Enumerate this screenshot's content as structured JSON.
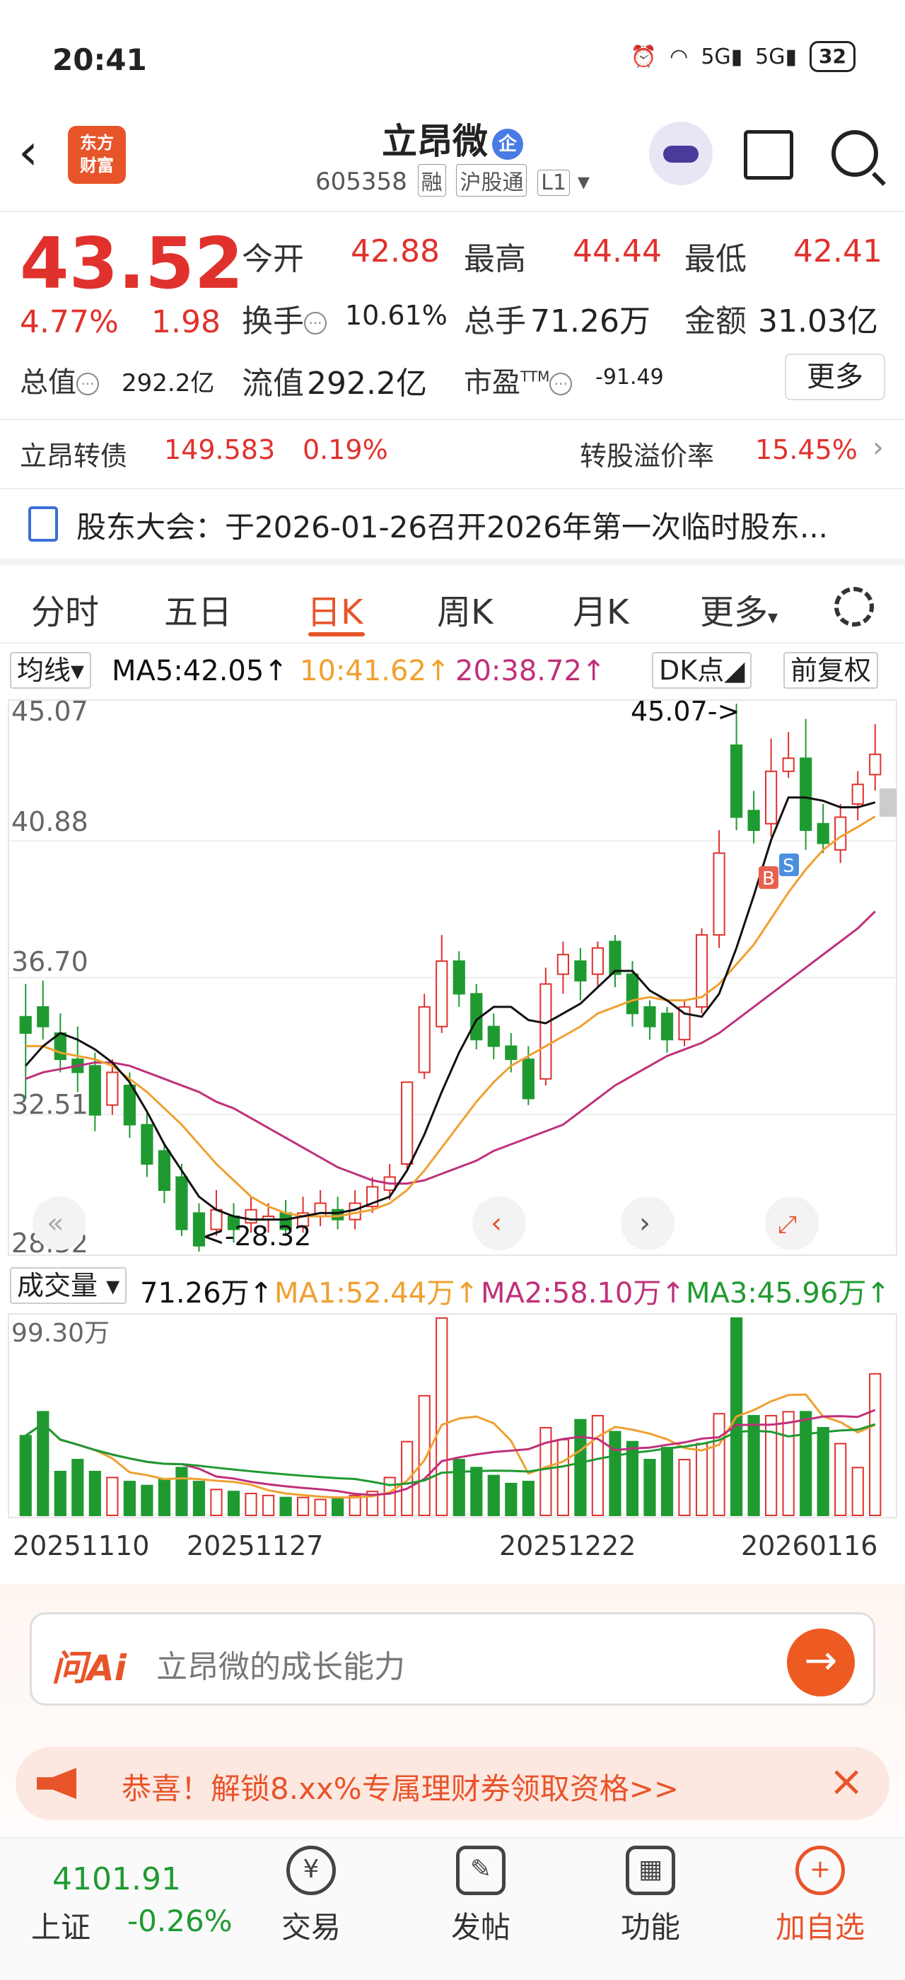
{
  "status_bar": {
    "time": "20:41",
    "signal1": "5G",
    "signal2": "5G",
    "battery": "32"
  },
  "header": {
    "title": "立昂微",
    "badge": "企",
    "code": "605358",
    "tags": [
      "融",
      "沪股通",
      "L1"
    ],
    "logo_line1": "东方",
    "logo_line2": "财富"
  },
  "quote": {
    "price": "43.52",
    "change_pct": "4.77%",
    "change": "1.98",
    "open_label": "今开",
    "open": "42.88",
    "high_label": "最高",
    "high": "44.44",
    "low_label": "最低",
    "low": "42.41",
    "turnover_label": "换手",
    "turnover": "10.61%",
    "volume_label": "总手",
    "volume": "71.26万",
    "amount_label": "金额",
    "amount": "31.03亿",
    "mcap_label": "总值",
    "mcap": "292.2亿",
    "float_label": "流值",
    "float": "292.2亿",
    "pe_label": "市盈",
    "pe_sup": "TTM",
    "pe": "-91.49",
    "more": "更多"
  },
  "bond": {
    "name": "立昂转债",
    "price": "149.583",
    "pct": "0.19%",
    "premium_label": "转股溢价率",
    "premium": "15.45%"
  },
  "notice": {
    "text": "股东大会：于2026-01-26召开2026年第一次临时股东..."
  },
  "tabs": [
    {
      "label": "分时"
    },
    {
      "label": "五日"
    },
    {
      "label": "日K"
    },
    {
      "label": "周K"
    },
    {
      "label": "月K"
    },
    {
      "label": "更多"
    }
  ],
  "chart_header": {
    "ma_select": "均线",
    "ma5": "MA5:42.05↑",
    "ma10": "10:41.62↑",
    "ma20": "20:38.72↑",
    "dk": "DK点",
    "adjust": "前复权"
  },
  "chart_labels": {
    "y1": "45.07",
    "y2": "40.88",
    "y3": "36.70",
    "y4": "32.51",
    "y5": "28.32",
    "high_note": "45.07->",
    "low_note": "<-28.32",
    "buy": "B",
    "sell": "S"
  },
  "volume_header": {
    "select": "成交量",
    "vol": "71.26万↑",
    "ma1": "MA1:52.44万↑",
    "ma2": "MA2:58.10万↑",
    "ma3": "MA3:45.96万↑",
    "ymax": "99.30万"
  },
  "dates": [
    "20251110",
    "20251127",
    "20251222",
    "20260116"
  ],
  "ai": {
    "logo": "问Ai",
    "placeholder": "立昂微的成长能力"
  },
  "promo": {
    "text": "恭喜！解锁8.xx%专属理财券领取资格>>"
  },
  "index": {
    "value": "4101.91",
    "name": "上证",
    "pct": "-0.26%"
  },
  "nav": [
    {
      "label": "交易"
    },
    {
      "label": "发帖"
    },
    {
      "label": "功能"
    },
    {
      "label": "加自选"
    }
  ],
  "colors": {
    "up": "#e0312d",
    "down": "#1f9a31",
    "ma5": "#111111",
    "ma10": "#f0a030",
    "ma20": "#c0307a",
    "accent": "#e8542a"
  },
  "chart_data": {
    "type": "candlestick",
    "ylim": [
      28.32,
      45.07
    ],
    "candles": [
      [
        35.5,
        35.0,
        36.5,
        33.0
      ],
      [
        35.8,
        35.2,
        36.6,
        34.8
      ],
      [
        35.0,
        34.2,
        35.6,
        33.8
      ],
      [
        34.2,
        33.8,
        35.2,
        33.2
      ],
      [
        34.0,
        32.5,
        34.4,
        32.0
      ],
      [
        32.8,
        33.8,
        34.2,
        32.5
      ],
      [
        33.4,
        32.2,
        33.8,
        31.8
      ],
      [
        32.2,
        31.0,
        32.6,
        30.6
      ],
      [
        31.4,
        30.2,
        31.6,
        29.8
      ],
      [
        30.6,
        29.0,
        31.0,
        28.8
      ],
      [
        29.5,
        28.5,
        29.8,
        28.32
      ],
      [
        29.0,
        29.6,
        30.2,
        28.8
      ],
      [
        29.4,
        29.0,
        29.8,
        28.6
      ],
      [
        29.2,
        29.6,
        30.0,
        28.9
      ],
      [
        29.3,
        29.4,
        29.8,
        28.9
      ],
      [
        29.5,
        29.0,
        29.9,
        28.8
      ],
      [
        29.1,
        29.5,
        30.0,
        28.9
      ],
      [
        29.4,
        29.8,
        30.2,
        29.1
      ],
      [
        29.6,
        29.3,
        30.0,
        29.0
      ],
      [
        29.3,
        29.8,
        30.2,
        29.0
      ],
      [
        29.7,
        30.3,
        30.6,
        29.5
      ],
      [
        30.2,
        30.6,
        31.0,
        29.9
      ],
      [
        31.0,
        33.5,
        33.5,
        30.8
      ],
      [
        33.8,
        35.8,
        36.2,
        33.6
      ],
      [
        35.2,
        37.2,
        38.0,
        35.0
      ],
      [
        37.2,
        36.2,
        37.5,
        35.8
      ],
      [
        36.2,
        34.8,
        36.5,
        34.5
      ],
      [
        35.2,
        34.6,
        35.6,
        34.2
      ],
      [
        34.6,
        34.2,
        35.0,
        33.8
      ],
      [
        34.2,
        33.0,
        34.6,
        32.8
      ],
      [
        33.6,
        36.5,
        37.0,
        33.4
      ],
      [
        36.8,
        37.4,
        37.8,
        36.2
      ],
      [
        37.2,
        36.6,
        37.6,
        36.0
      ],
      [
        36.8,
        37.6,
        37.8,
        36.4
      ],
      [
        37.8,
        36.8,
        38.0,
        36.4
      ],
      [
        36.8,
        35.6,
        37.2,
        35.2
      ],
      [
        35.8,
        35.2,
        36.0,
        34.8
      ],
      [
        35.6,
        34.8,
        35.8,
        34.4
      ],
      [
        34.8,
        35.8,
        36.0,
        34.6
      ],
      [
        35.8,
        38.0,
        38.2,
        35.6
      ],
      [
        38.0,
        40.5,
        41.2,
        37.6
      ],
      [
        43.8,
        41.6,
        45.07,
        41.2
      ],
      [
        41.8,
        41.2,
        42.4,
        40.8
      ],
      [
        41.4,
        43.0,
        44.0,
        41.0
      ],
      [
        43.0,
        43.4,
        44.2,
        42.8
      ],
      [
        43.4,
        41.2,
        44.6,
        40.6
      ],
      [
        41.4,
        40.8,
        42.0,
        40.5
      ],
      [
        40.6,
        41.6,
        42.0,
        40.2
      ],
      [
        42.0,
        42.6,
        43.0,
        41.5
      ],
      [
        42.9,
        43.52,
        44.44,
        42.41
      ]
    ],
    "ma5": [
      34.0,
      34.6,
      35.0,
      34.8,
      34.5,
      34.1,
      33.5,
      32.6,
      31.6,
      30.8,
      30.0,
      29.6,
      29.4,
      29.3,
      29.3,
      29.3,
      29.4,
      29.5,
      29.5,
      29.6,
      29.8,
      30.0,
      30.8,
      31.9,
      33.2,
      34.4,
      35.4,
      35.8,
      35.8,
      35.4,
      35.3,
      35.6,
      35.9,
      36.4,
      36.9,
      36.9,
      36.3,
      36.0,
      35.6,
      35.5,
      36.2,
      37.6,
      39.2,
      40.9,
      42.2,
      42.2,
      42.1,
      41.9,
      41.9,
      42.05
    ],
    "ma10": [
      34.6,
      34.6,
      34.4,
      34.3,
      34.2,
      34.0,
      33.6,
      33.2,
      32.7,
      32.2,
      31.6,
      31.0,
      30.5,
      30.0,
      29.7,
      29.5,
      29.4,
      29.4,
      29.4,
      29.5,
      29.6,
      29.8,
      30.2,
      30.8,
      31.5,
      32.2,
      32.9,
      33.5,
      34.0,
      34.3,
      34.6,
      34.9,
      35.2,
      35.6,
      35.8,
      36.0,
      36.1,
      36.0,
      36.0,
      36.1,
      36.5,
      37.1,
      37.7,
      38.5,
      39.3,
      40.0,
      40.6,
      41.0,
      41.3,
      41.62
    ],
    "ma20": [
      33.6,
      33.8,
      33.9,
      34.0,
      34.1,
      34.1,
      34.0,
      33.8,
      33.6,
      33.4,
      33.2,
      32.9,
      32.7,
      32.4,
      32.1,
      31.8,
      31.5,
      31.2,
      30.9,
      30.7,
      30.5,
      30.4,
      30.4,
      30.5,
      30.7,
      30.9,
      31.1,
      31.4,
      31.6,
      31.8,
      32.0,
      32.2,
      32.6,
      33.0,
      33.4,
      33.7,
      34.0,
      34.3,
      34.5,
      34.7,
      35.0,
      35.4,
      35.8,
      36.2,
      36.6,
      37.0,
      37.4,
      37.8,
      38.2,
      38.72
    ],
    "volume": [
      40,
      52,
      22,
      28,
      22,
      19,
      17,
      15,
      18,
      24,
      17,
      13,
      12,
      11,
      10,
      9,
      9,
      8,
      9,
      10,
      12,
      19,
      37,
      60,
      99,
      28,
      24,
      20,
      16,
      17,
      44,
      38,
      48,
      50,
      42,
      37,
      28,
      34,
      28,
      36,
      51,
      99,
      50,
      50,
      52,
      52,
      44,
      36,
      24,
      71
    ],
    "volume_ylim": [
      0,
      99.3
    ]
  }
}
